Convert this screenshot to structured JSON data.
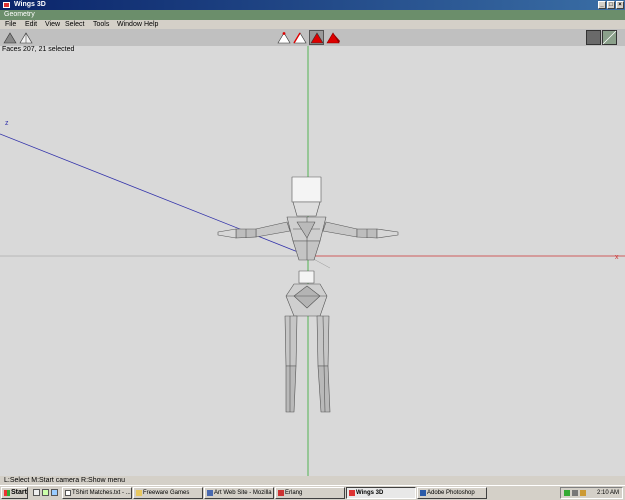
{
  "window": {
    "title": "Wings 3D"
  },
  "geometry_bar": {
    "label": "Geometry"
  },
  "menu": {
    "items": [
      "File",
      "Edit",
      "View",
      "Select",
      "Tools",
      "Window",
      "Help"
    ]
  },
  "status": {
    "selection_info": "Faces 207, 21 selected"
  },
  "viewport": {
    "axis_z_label": "z",
    "axis_x_label": "x",
    "colors": {
      "background": "#d9d9d9",
      "x_axis": "#cc3333",
      "y_axis": "#33aa33",
      "z_axis": "#3333aa",
      "face": "#d8d8d8",
      "selected": "#bdbdbd",
      "edge": "#555555"
    }
  },
  "help": {
    "text": "L:Select  M:Start camera  R:Show menu"
  },
  "taskbar": {
    "start_label": "Start",
    "tasks": [
      "TShirt Matches.txt - ...",
      "Freeware Games",
      "Art Web Site - Mozilla",
      "Erlang",
      "Wings 3D",
      "Adobe Photoshop"
    ],
    "clock": "2:10 AM"
  }
}
